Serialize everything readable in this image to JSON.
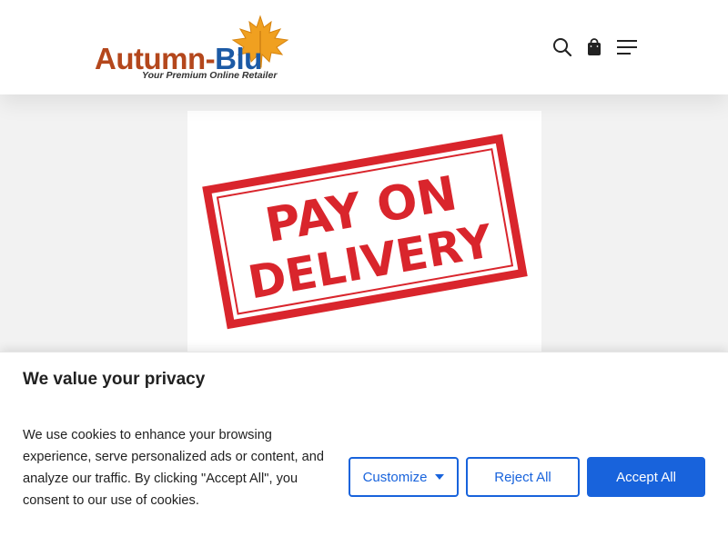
{
  "header": {
    "logo": {
      "word_main": "Autumn-",
      "word_accent": "Blu",
      "tagline": "Your Premium Online Retailer"
    },
    "icons": {
      "search": "search-icon",
      "cart": "shopping-bag-icon",
      "menu": "hamburger-menu-icon"
    }
  },
  "product": {
    "stamp_line_1": "PAY ON",
    "stamp_line_2": "DELIVERY"
  },
  "cookie_banner": {
    "title": "We value your privacy",
    "body": "We use cookies to enhance your browsing experience, serve personalized ads or content, and analyze our traffic. By clicking \"Accept All\", you consent to our use of cookies.",
    "customize_label": "Customize",
    "reject_label": "Reject All",
    "accept_label": "Accept All"
  },
  "colors": {
    "brand_orange": "#b4471c",
    "brand_blue": "#1c5aa5",
    "leaf": "#f0a020",
    "stamp_red": "#d9252c",
    "button_blue": "#1863dc"
  }
}
